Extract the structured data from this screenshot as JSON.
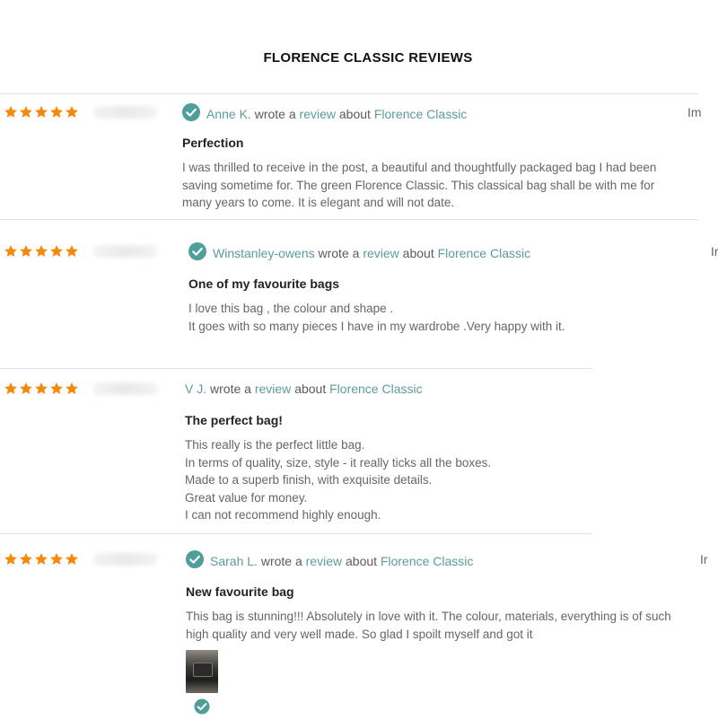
{
  "page": {
    "title": "FLORENCE CLASSIC REVIEWS"
  },
  "colors": {
    "star": "#f5890d",
    "verified": "#4e9e99",
    "link": "#5b9c9b"
  },
  "icons": {
    "star": "star-icon",
    "verified": "verified-check-icon"
  },
  "reviews": [
    {
      "rating": 5,
      "verified": true,
      "reviewer": "Anne K.",
      "wrote_text": "wrote a",
      "review_link": "review",
      "about_text": "about",
      "product_link": "Florence Classic",
      "title": "Perfection",
      "body": [
        "I was thrilled to receive in the post, a beautiful and thoughtfully packaged bag I had been",
        "saving sometime for. The green Florence Classic. This classical bag shall be with me for",
        "many years to come. It is elegant and will not date."
      ],
      "cut_text": "Im"
    },
    {
      "rating": 5,
      "verified": true,
      "reviewer": "Winstanley-owens",
      "wrote_text": "wrote a",
      "review_link": "review",
      "about_text": "about",
      "product_link": "Florence Classic",
      "title": "One of my favourite bags",
      "body": [
        "I love this bag , the colour and shape .",
        "It goes with so many pieces I have in my wardrobe .Very happy with it."
      ],
      "cut_text": "Ir"
    },
    {
      "rating": 5,
      "verified": false,
      "reviewer": "V J.",
      "wrote_text": "wrote a",
      "review_link": "review",
      "about_text": "about",
      "product_link": "Florence Classic",
      "title": "The perfect bag!",
      "body": [
        "This really is the perfect little bag.",
        "In terms of quality, size, style - it really ticks all the boxes.",
        "Made to a superb finish, with exquisite details.",
        "Great value for money.",
        "I can not recommend highly enough."
      ]
    },
    {
      "rating": 5,
      "verified": true,
      "reviewer": "Sarah L.",
      "wrote_text": "wrote a",
      "review_link": "review",
      "about_text": "about",
      "product_link": "Florence Classic",
      "title": "New favourite bag",
      "body": [
        "This bag is stunning!!! Absolutely in love with it. The colour, materials, everything is of such",
        "high quality and very well made. So glad I spoilt myself and got it"
      ],
      "cut_text": "Ir"
    }
  ]
}
